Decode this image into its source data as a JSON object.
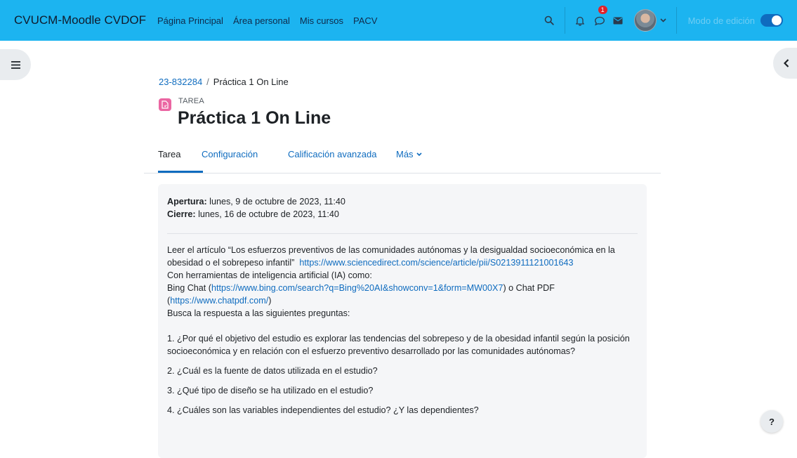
{
  "navbar": {
    "brand": "CVUCM-Moodle CVDOF",
    "links": [
      "Página Principal",
      "Área personal",
      "Mis cursos",
      "PACV"
    ],
    "notification_badge": "1",
    "edit_mode_label": "Modo de edición",
    "edit_mode_on": true,
    "colors": {
      "bar": "#1cb4f0",
      "badge": "#e0222a",
      "toggle": "#0f6cbf"
    }
  },
  "breadcrumb": {
    "course": "23-832284",
    "separator": "/",
    "current": "Práctica 1 On Line"
  },
  "activity": {
    "type_label": "TAREA",
    "title": "Práctica 1 On Line",
    "icon_color": "#eb66a2"
  },
  "tabs": [
    {
      "label": "Tarea",
      "active": true
    },
    {
      "label": "Configuración",
      "active": false
    },
    {
      "label": "Calificación avanzada",
      "active": false
    },
    {
      "label": "Más",
      "active": false
    }
  ],
  "dates": {
    "open_label": "Apertura:",
    "open_value": " lunes, 9 de octubre de 2023, 11:40",
    "close_label": "Cierre:",
    "close_value": " lunes, 16 de octubre de 2023, 11:40"
  },
  "description": {
    "line1": "Leer el artículo “Los esfuerzos preventivos de las comunidades autónomas y la desigualdad socioeconómica en la",
    "line2_text": "obesidad o el sobrepeso infantil”",
    "line2_link": "https://www.sciencedirect.com/science/article/pii/S0213911121001643",
    "line3": "Con herramientas de inteligencia artificial (IA) como:",
    "bing_prefix": "Bing Chat (",
    "bing_link": "https://www.bing.com/search?q=Bing%20AI&showconv=1&form=MW00X7",
    "bing_suffix": ") o Chat PDF",
    "chatpdf_prefix": "(",
    "chatpdf_link": "https://www.chatpdf.com/",
    "chatpdf_suffix": ")",
    "line6": "Busca la respuesta a las siguientes preguntas:"
  },
  "questions": [
    "1. ¿Por qué el objetivo del estudio es explorar las tendencias del sobrepeso y de la obesidad infantil según la posición socioeconómica y en relación con el esfuerzo preventivo desarrollado por las comunidades autónomas?",
    "2. ¿Cuál es la fuente de datos utilizada en el estudio?",
    "3. ¿Qué tipo de diseño se ha utilizado en el estudio?",
    "4. ¿Cuáles son las variables independientes del estudio? ¿Y las dependientes?"
  ],
  "help_label": "?"
}
